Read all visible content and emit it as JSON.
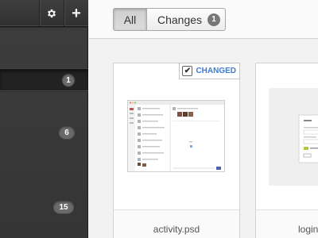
{
  "toolbar": {
    "gear_icon": "gear-icon",
    "add_icon": "plus-icon",
    "add_glyph": "+"
  },
  "sidebar": {
    "badges": [
      "1",
      "6",
      "15"
    ]
  },
  "filter": {
    "all_label": "All",
    "changes_label": "Changes",
    "changes_count": "1"
  },
  "cards": [
    {
      "name": "activity.psd",
      "tag": "CHANGED",
      "checked": true
    },
    {
      "name": "login",
      "tag": "",
      "checked": false
    }
  ],
  "colors": {
    "sidebar_bg": "#3a3a3a",
    "accent": "#3d7bd6",
    "badge": "#6a6a6a"
  }
}
